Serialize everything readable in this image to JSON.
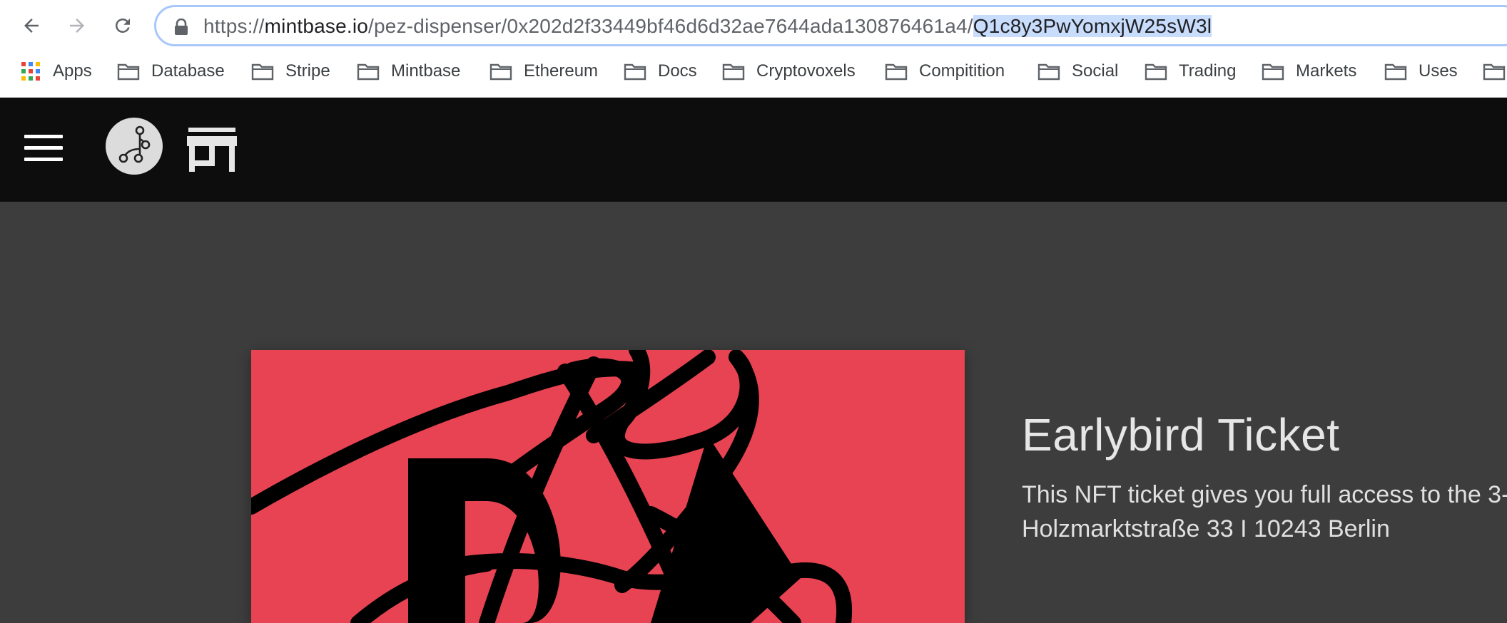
{
  "browser": {
    "url_prefix": "https://",
    "url_host": "mintbase.io",
    "url_path": "/pez-dispenser/0x202d2f33449bf46d6d32ae7644ada130876461a4/",
    "url_selected": "Q1c8y3PwYomxjW25sW3l",
    "bookmarks": [
      {
        "label": "Apps",
        "icon": "apps-grid-icon"
      },
      {
        "label": "Database",
        "icon": "folder-icon"
      },
      {
        "label": "Stripe",
        "icon": "folder-icon"
      },
      {
        "label": "Mintbase",
        "icon": "folder-icon"
      },
      {
        "label": "Ethereum",
        "icon": "folder-icon"
      },
      {
        "label": "Docs",
        "icon": "folder-icon"
      },
      {
        "label": "Cryptovoxels",
        "icon": "folder-icon"
      },
      {
        "label": "Compitition",
        "icon": "folder-icon"
      },
      {
        "label": "Social",
        "icon": "folder-icon"
      },
      {
        "label": "Trading",
        "icon": "folder-icon"
      },
      {
        "label": "Markets",
        "icon": "folder-icon"
      },
      {
        "label": "Uses",
        "icon": "folder-icon"
      }
    ],
    "omnibox_border_color": "#a8c7fa",
    "selection_color": "#c8dcfb"
  },
  "header": {
    "background_color": "#0d0d0d",
    "icons": [
      "menu-icon",
      "mintbase-logo-icon",
      "store-icon"
    ]
  },
  "main": {
    "background_color": "#3d3d3d",
    "ticket": {
      "title": "Earlybird Ticket",
      "description_line1": "This NFT ticket gives you full access to the 3-",
      "description_line2": "Holzmarktstraße 33 I 10243 Berlin",
      "image_background_color": "#e84352"
    }
  }
}
